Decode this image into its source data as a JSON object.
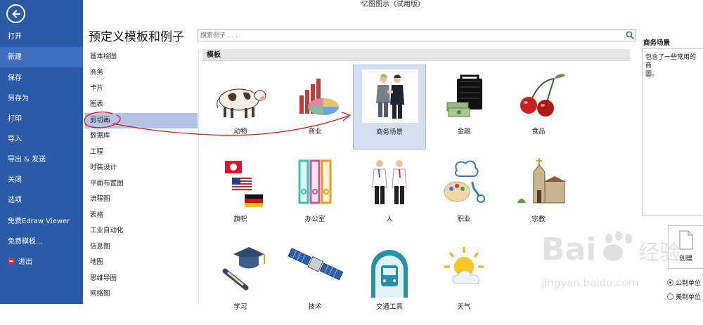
{
  "window": {
    "title": "亿图图示（试用版）"
  },
  "sidebar": {
    "back_icon": "back-arrow-icon",
    "items": [
      {
        "label": "打开"
      },
      {
        "label": "新建",
        "active": true
      },
      {
        "label": "保存"
      },
      {
        "label": "另存为"
      },
      {
        "label": "打印"
      },
      {
        "label": "导入"
      },
      {
        "label": "导出 & 发送"
      },
      {
        "label": "关闭"
      },
      {
        "label": "选项"
      },
      {
        "label": "免费Edraw Viewer"
      },
      {
        "label": "免费模板..."
      },
      {
        "label": "退出",
        "icon": "exit-icon"
      }
    ]
  },
  "main": {
    "title": "预定义模板和例子",
    "search": {
      "placeholder": "搜索例子 . . .",
      "value": ""
    }
  },
  "categories": [
    "基本绘图",
    "商务",
    "卡片",
    "图表",
    "剪切画",
    "数据库",
    "工程",
    "时装设计",
    "平面布置图",
    "流程图",
    "表格",
    "工业自动化",
    "信息图",
    "地图",
    "思维导图",
    "网络图"
  ],
  "active_category": "剪切画",
  "templates": {
    "header": "模板",
    "items": [
      {
        "label": "动物",
        "icon": "cow-icon"
      },
      {
        "label": "商业",
        "icon": "bar-pie-chart-icon"
      },
      {
        "label": "商务场景",
        "icon": "handshake-icon",
        "selected": true
      },
      {
        "label": "金融",
        "icon": "money-briefcase-icon"
      },
      {
        "label": "食品",
        "icon": "cherries-icon"
      },
      {
        "label": "旗帜",
        "icon": "flags-icon"
      },
      {
        "label": "办公室",
        "icon": "binders-icon"
      },
      {
        "label": "人",
        "icon": "people-icon"
      },
      {
        "label": "职业",
        "icon": "chef-hat-palette-icon"
      },
      {
        "label": "宗教",
        "icon": "church-icon"
      },
      {
        "label": "学习",
        "icon": "graduation-cap-icon"
      },
      {
        "label": "技术",
        "icon": "satellite-icon"
      },
      {
        "label": "交通工具",
        "icon": "train-icon"
      },
      {
        "label": "天气",
        "icon": "sun-cloud-icon"
      }
    ]
  },
  "details": {
    "title": "商务场景",
    "description": "包含了一些常用的商\n圖。",
    "create_label": "创建",
    "units": [
      {
        "label": "公制单位",
        "selected": true
      },
      {
        "label": "美制单位",
        "selected": false
      }
    ]
  },
  "watermark": {
    "text": "Bai",
    "sub": "jingyan.baidu.com",
    "brand": "经验"
  }
}
